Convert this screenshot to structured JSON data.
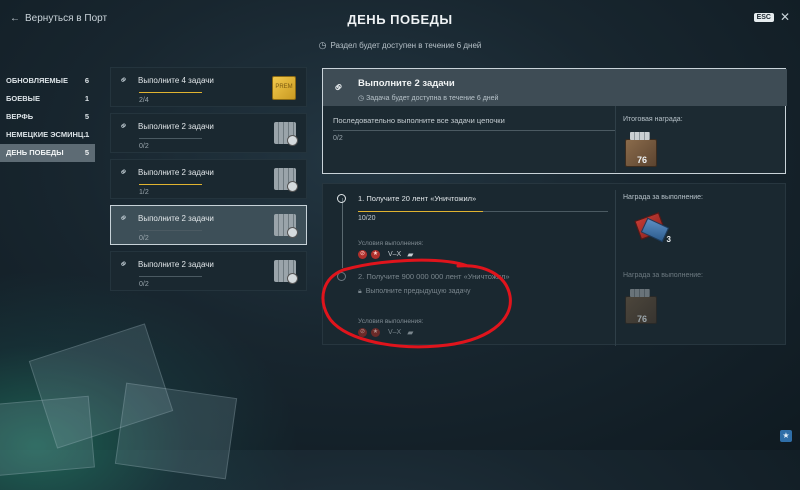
{
  "header": {
    "back_label": "Вернуться в Порт",
    "title": "ДЕНЬ ПОБЕДЫ",
    "subtitle": "Раздел будет доступен в течение 6 дней",
    "esc_label": "ESC"
  },
  "categories": [
    {
      "label": "ОБНОВЛЯЕМЫЕ",
      "count": "6"
    },
    {
      "label": "БОЕВЫЕ",
      "count": "1"
    },
    {
      "label": "ВЕРФЬ",
      "count": "5"
    },
    {
      "label": "НЕМЕЦКИЕ ЭСМИНЦ...",
      "count": "1"
    },
    {
      "label": "ДЕНЬ ПОБЕДЫ",
      "count": "5"
    }
  ],
  "tasks": [
    {
      "title": "Выполните 4 задачи",
      "progress": "2/4",
      "fill": 1.0,
      "reward": "gold",
      "reward_text": "PREM"
    },
    {
      "title": "Выполните 2 задачи",
      "progress": "0/2",
      "fill": 0,
      "reward": "coins"
    },
    {
      "title": "Выполните 2 задачи",
      "progress": "1/2",
      "fill": 1.0,
      "reward": "coins"
    },
    {
      "title": "Выполните 2 задачи",
      "progress": "0/2",
      "fill": 0,
      "reward": "coins"
    },
    {
      "title": "Выполните 2 задачи",
      "progress": "0/2",
      "fill": 0,
      "reward": "coins"
    }
  ],
  "detail": {
    "title": "Выполните 2 задачи",
    "subtitle": "Задача будет доступна в течение 6 дней",
    "description": "Последовательно выполните все задачи цепочки",
    "progress": "0/2",
    "reward_label": "Итоговая награда:",
    "reward_count": "76"
  },
  "steps": [
    {
      "title": "1. Получите 20 лент «Уничтожил»",
      "progress": "10/20",
      "fill": 0.5,
      "conditions_label": "Условия выполнения:",
      "tiers": "V–X",
      "reward_label": "Награда за выполнение:",
      "reward_count": "3"
    },
    {
      "title": "2. Получите 900 000 000 лент «Уничтожил»",
      "lock_text": "Выполните предыдущую задачу",
      "conditions_label": "Условия выполнения:",
      "tiers": "V–X",
      "reward_label": "Награда за выполнение:",
      "reward_count": "76"
    }
  ],
  "colors": {
    "accent_progress": "#e0b330",
    "annotation": "#e0141c"
  },
  "icons": {
    "back": "arrow-left-icon",
    "close": "close-icon",
    "chain": "chain-link-icon",
    "clock": "clock-icon",
    "lock": "lock-icon"
  }
}
